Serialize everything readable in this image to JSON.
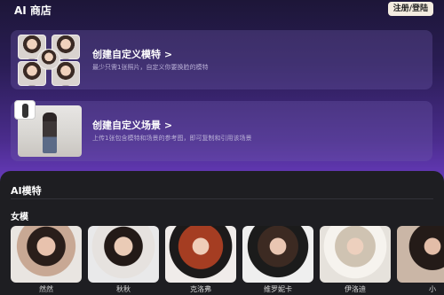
{
  "header": {
    "app_title": "AI 商店",
    "login_label": "注册/登陆"
  },
  "cards": [
    {
      "title": "创建自定义模特 >",
      "subtitle": "最少只需1张照片，自定义你要换脸的模特"
    },
    {
      "title": "创建自定义场景 >",
      "subtitle": "上传1张包含模特和场景的参考图，即可复制和引用该场景"
    }
  ],
  "section": {
    "title": "AI模特",
    "subsection": "女模"
  },
  "models": [
    {
      "name": "然然"
    },
    {
      "name": "秋秋"
    },
    {
      "name": "克洛弗"
    },
    {
      "name": "维罗妮卡"
    },
    {
      "name": "伊洛迪"
    },
    {
      "name": "小"
    }
  ]
}
